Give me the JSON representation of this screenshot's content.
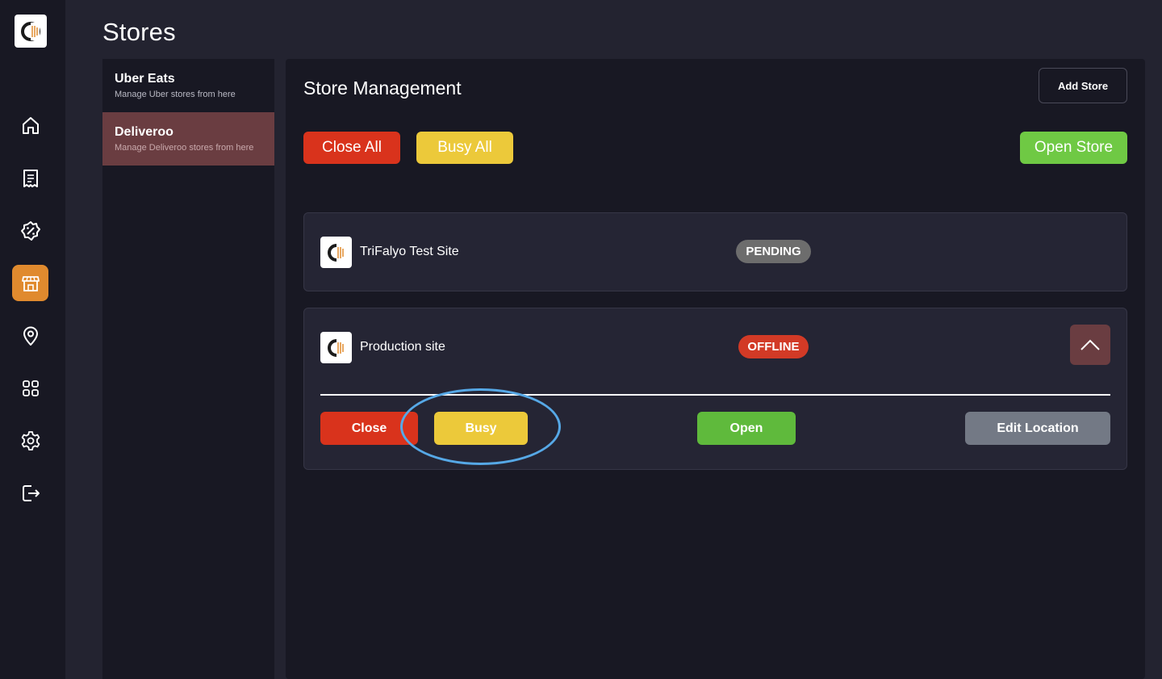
{
  "page": {
    "title": "Stores"
  },
  "providers": [
    {
      "name": "Uber Eats",
      "description": "Manage Uber stores from here",
      "active": false
    },
    {
      "name": "Deliveroo",
      "description": "Manage Deliveroo stores from here",
      "active": true
    }
  ],
  "nav": {
    "items": [
      {
        "icon": "home-icon"
      },
      {
        "icon": "receipt-icon"
      },
      {
        "icon": "discount-icon"
      },
      {
        "icon": "store-icon",
        "active": true
      },
      {
        "icon": "location-pin-icon"
      },
      {
        "icon": "grid-icon"
      },
      {
        "icon": "gear-icon"
      },
      {
        "icon": "logout-icon"
      }
    ]
  },
  "management": {
    "title": "Store Management",
    "add_store_label": "Add Store",
    "close_all_label": "Close All",
    "busy_all_label": "Busy All",
    "open_store_label": "Open Store"
  },
  "stores": [
    {
      "name": "TriFalyo Test Site",
      "status": "PENDING"
    },
    {
      "name": "Production site",
      "status": "OFFLINE",
      "expanded": true,
      "actions": {
        "close_label": "Close",
        "busy_label": "Busy",
        "open_label": "Open",
        "edit_location_label": "Edit Location"
      }
    }
  ],
  "colors": {
    "accent_orange": "#e08a2e",
    "active_provider": "#6a3d41",
    "red": "#d9331c",
    "yellow": "#ecc93a",
    "green": "#6fc944",
    "gray": "#737985",
    "annotation_blue": "#56a8e6"
  }
}
